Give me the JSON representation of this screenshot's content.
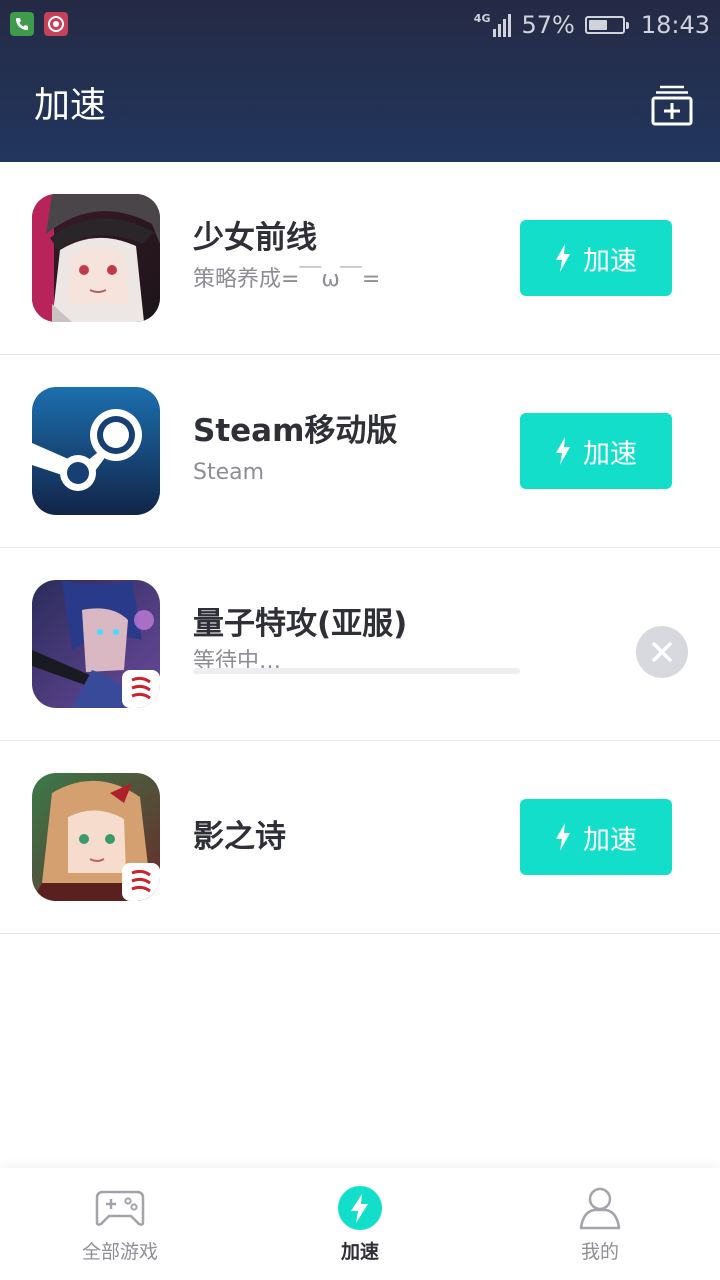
{
  "status_bar": {
    "network_label": "4G",
    "battery_text": "57%",
    "battery_level": 0.57,
    "time": "18:43"
  },
  "header": {
    "title": "加速",
    "add_icon": "add-game-icon"
  },
  "games": [
    {
      "name": "少女前线",
      "subtitle": "策略养成=￣ω￣=",
      "state": "idle",
      "button_label": "加速"
    },
    {
      "name": "Steam移动版",
      "subtitle": "Steam",
      "state": "idle",
      "button_label": "加速"
    },
    {
      "name": "量子特攻(亚服)",
      "subtitle": "等待中…",
      "state": "waiting",
      "progress": 0
    },
    {
      "name": "影之诗",
      "subtitle": "",
      "state": "idle",
      "button_label": "加速"
    }
  ],
  "bottom_nav": [
    {
      "label": "全部游戏",
      "icon": "gamepad-icon",
      "active": false
    },
    {
      "label": "加速",
      "icon": "lightning-icon",
      "active": true
    },
    {
      "label": "我的",
      "icon": "person-icon",
      "active": false
    }
  ],
  "colors": {
    "header_top": "#242a44",
    "header_bottom": "#22365f",
    "accent": "#13dec9",
    "text_primary": "#2f2f38",
    "text_secondary": "#8d8d96"
  }
}
